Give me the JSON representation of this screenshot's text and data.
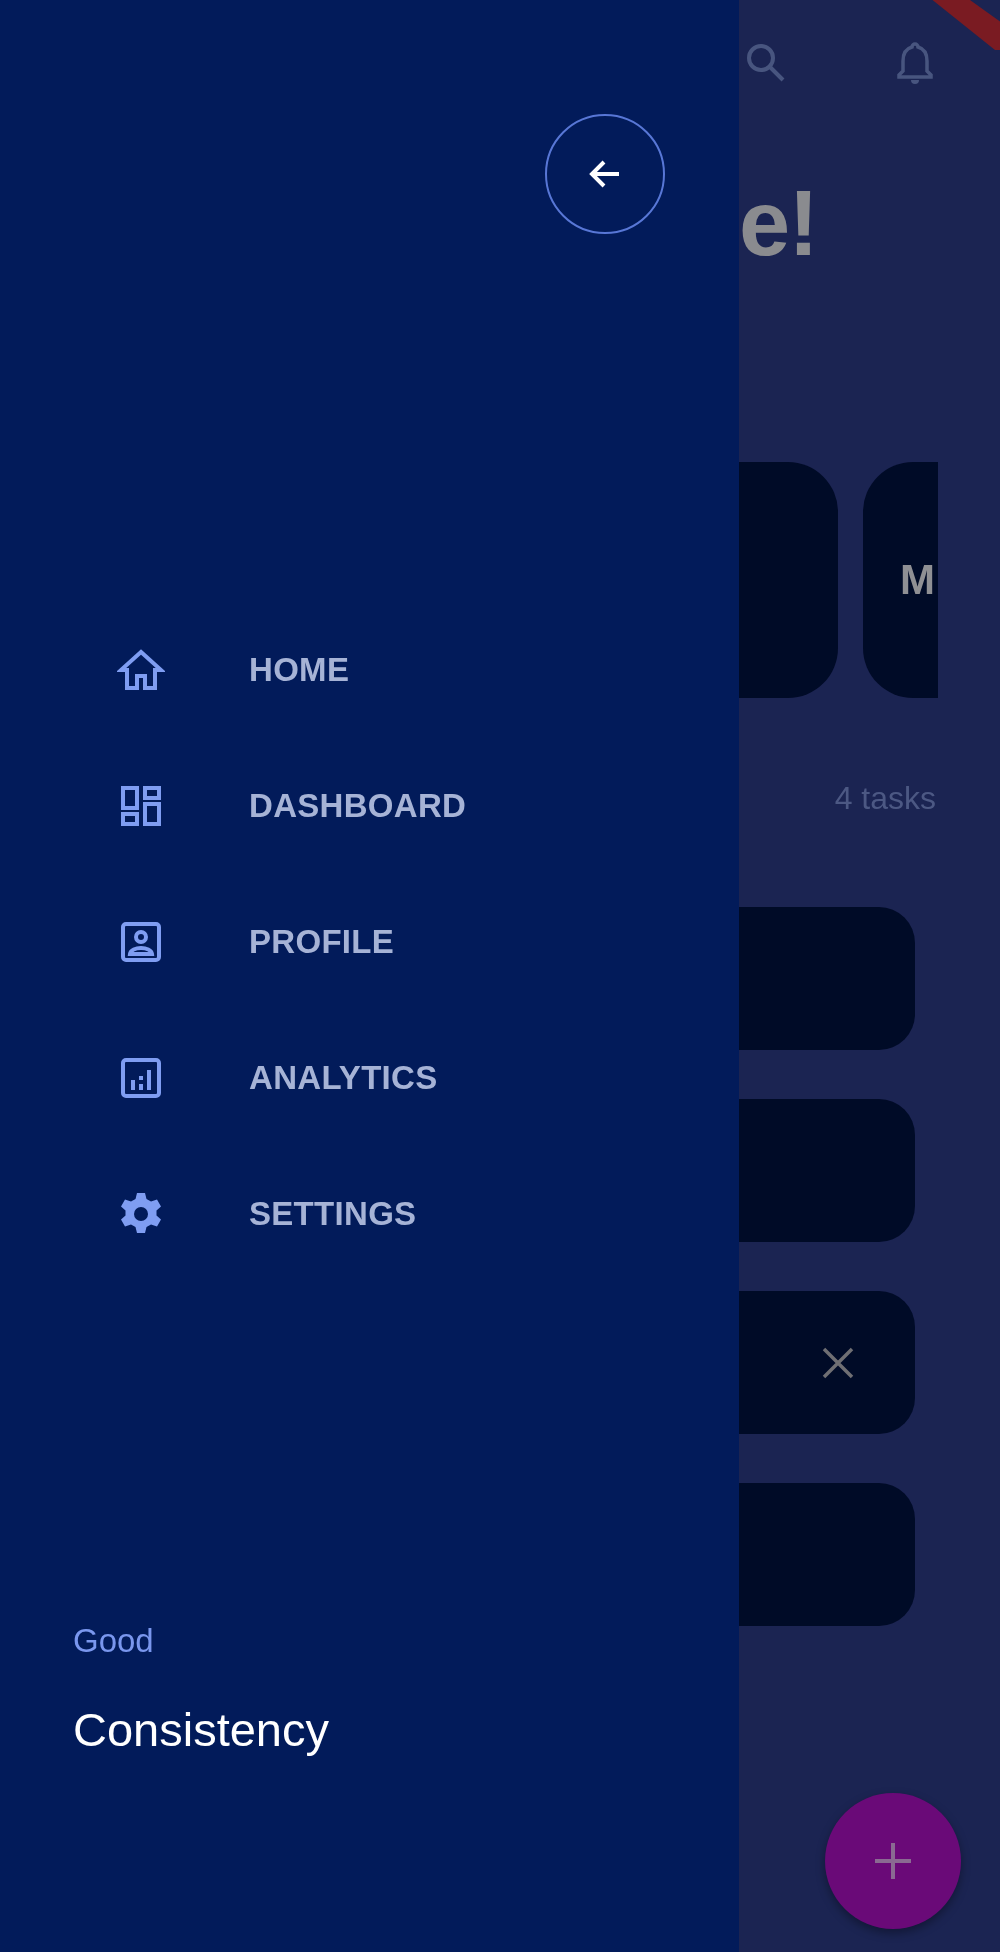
{
  "drawer": {
    "menu": [
      {
        "label": "HOME",
        "selected": false
      },
      {
        "label": "DASHBOARD",
        "selected": false
      },
      {
        "label": "PROFILE",
        "selected": false
      },
      {
        "label": "ANALYTICS",
        "selected": false
      },
      {
        "label": "SETTINGS",
        "selected": false
      }
    ],
    "footer": {
      "caption": "Good",
      "title": "Consistency"
    }
  },
  "background": {
    "heading": "e!",
    "category_card_label": "M",
    "task_count": "4 tasks",
    "task_cards": [
      {
        "removable": false
      },
      {
        "removable": false
      },
      {
        "removable": true
      },
      {
        "removable": false
      }
    ]
  }
}
